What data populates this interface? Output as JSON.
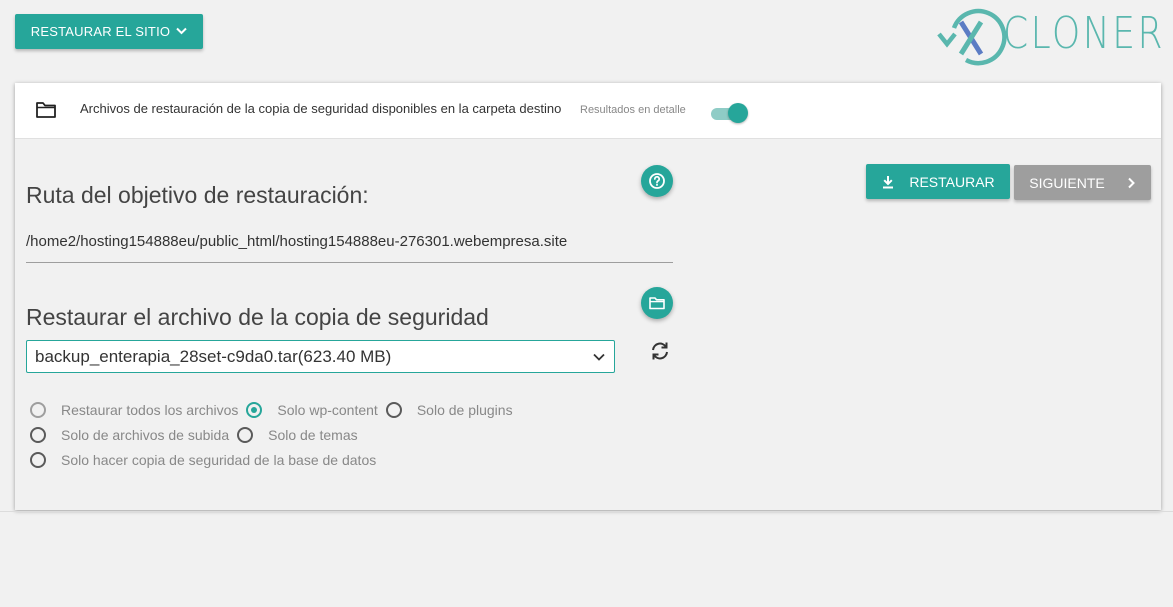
{
  "top": {
    "restore_site_label": "RESTAURAR EL SITIO"
  },
  "logo": {
    "text": "CLONER",
    "x_mark": "X"
  },
  "header": {
    "title": "Archivos de restauración de la copia de seguridad disponibles en la carpeta destino",
    "detail_label": "Resultados en detalle",
    "detail_toggle_on": true
  },
  "restore_target": {
    "title": "Ruta del objetivo de restauración:",
    "path": "/home2/hosting154888eu/public_html/hosting154888eu-276301.webempresa.site"
  },
  "backup_file": {
    "title": "Restaurar el archivo de la copia de seguridad",
    "selected": "backup_enterapia_28set-c9da0.tar(623.40 MB)"
  },
  "options": {
    "all_files": "Restaurar todos los archivos",
    "wp_content": "Solo wp-content",
    "plugins": "Solo de plugins",
    "uploads": "Solo de archivos de subida",
    "themes": "Solo de temas",
    "database": "Solo hacer copia de seguridad de la base de datos",
    "selected": "wp_content"
  },
  "actions": {
    "restore_label": "RESTAURAR",
    "next_label": "SIGUIENTE"
  },
  "colors": {
    "accent": "#26a69a",
    "accent_light": "#8fccc6",
    "disabled": "#9e9e9e",
    "logo": "#5ab7ae"
  }
}
